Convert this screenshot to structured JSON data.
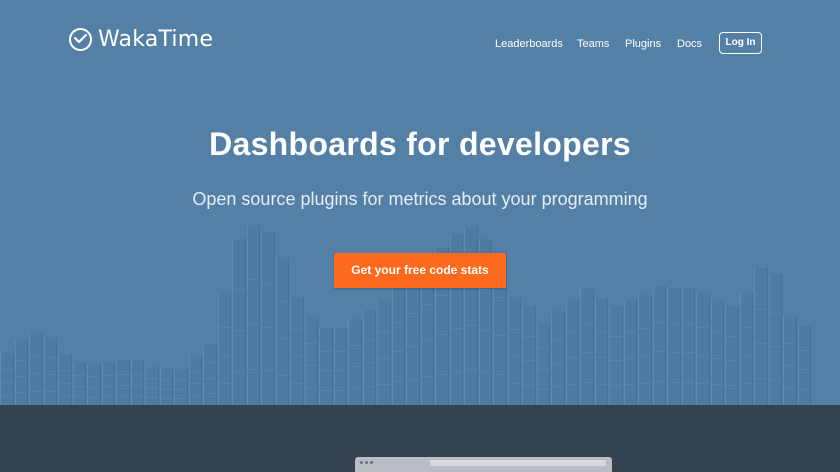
{
  "brand": {
    "name": "WakaTime",
    "logo_icon": "clock-check-icon"
  },
  "nav": {
    "links": [
      "Leaderboards",
      "Teams",
      "Plugins",
      "Docs"
    ],
    "login_label": "Log In"
  },
  "hero": {
    "title": "Dashboards for developers",
    "subtitle": "Open source plugins for metrics about your programming",
    "cta_label": "Get your free code stats"
  },
  "background_activity_levels": [
    0.29,
    0.36,
    0.4,
    0.38,
    0.28,
    0.24,
    0.23,
    0.24,
    0.25,
    0.25,
    0.21,
    0.2,
    0.2,
    0.27,
    0.34,
    0.62,
    0.92,
    1.0,
    0.96,
    0.82,
    0.6,
    0.49,
    0.43,
    0.43,
    0.48,
    0.53,
    0.58,
    0.66,
    0.73,
    0.8,
    0.87,
    0.95,
    0.99,
    0.92,
    0.86,
    0.6,
    0.55,
    0.45,
    0.52,
    0.59,
    0.65,
    0.59,
    0.55,
    0.58,
    0.61,
    0.66,
    0.65,
    0.65,
    0.62,
    0.58,
    0.55,
    0.62,
    0.76,
    0.73,
    0.49,
    0.44
  ],
  "colors": {
    "hero_bg": "#5580a6",
    "footer_bg": "#354250",
    "cta_bg": "#fd6a1d",
    "bar": "#4f7aa2"
  }
}
